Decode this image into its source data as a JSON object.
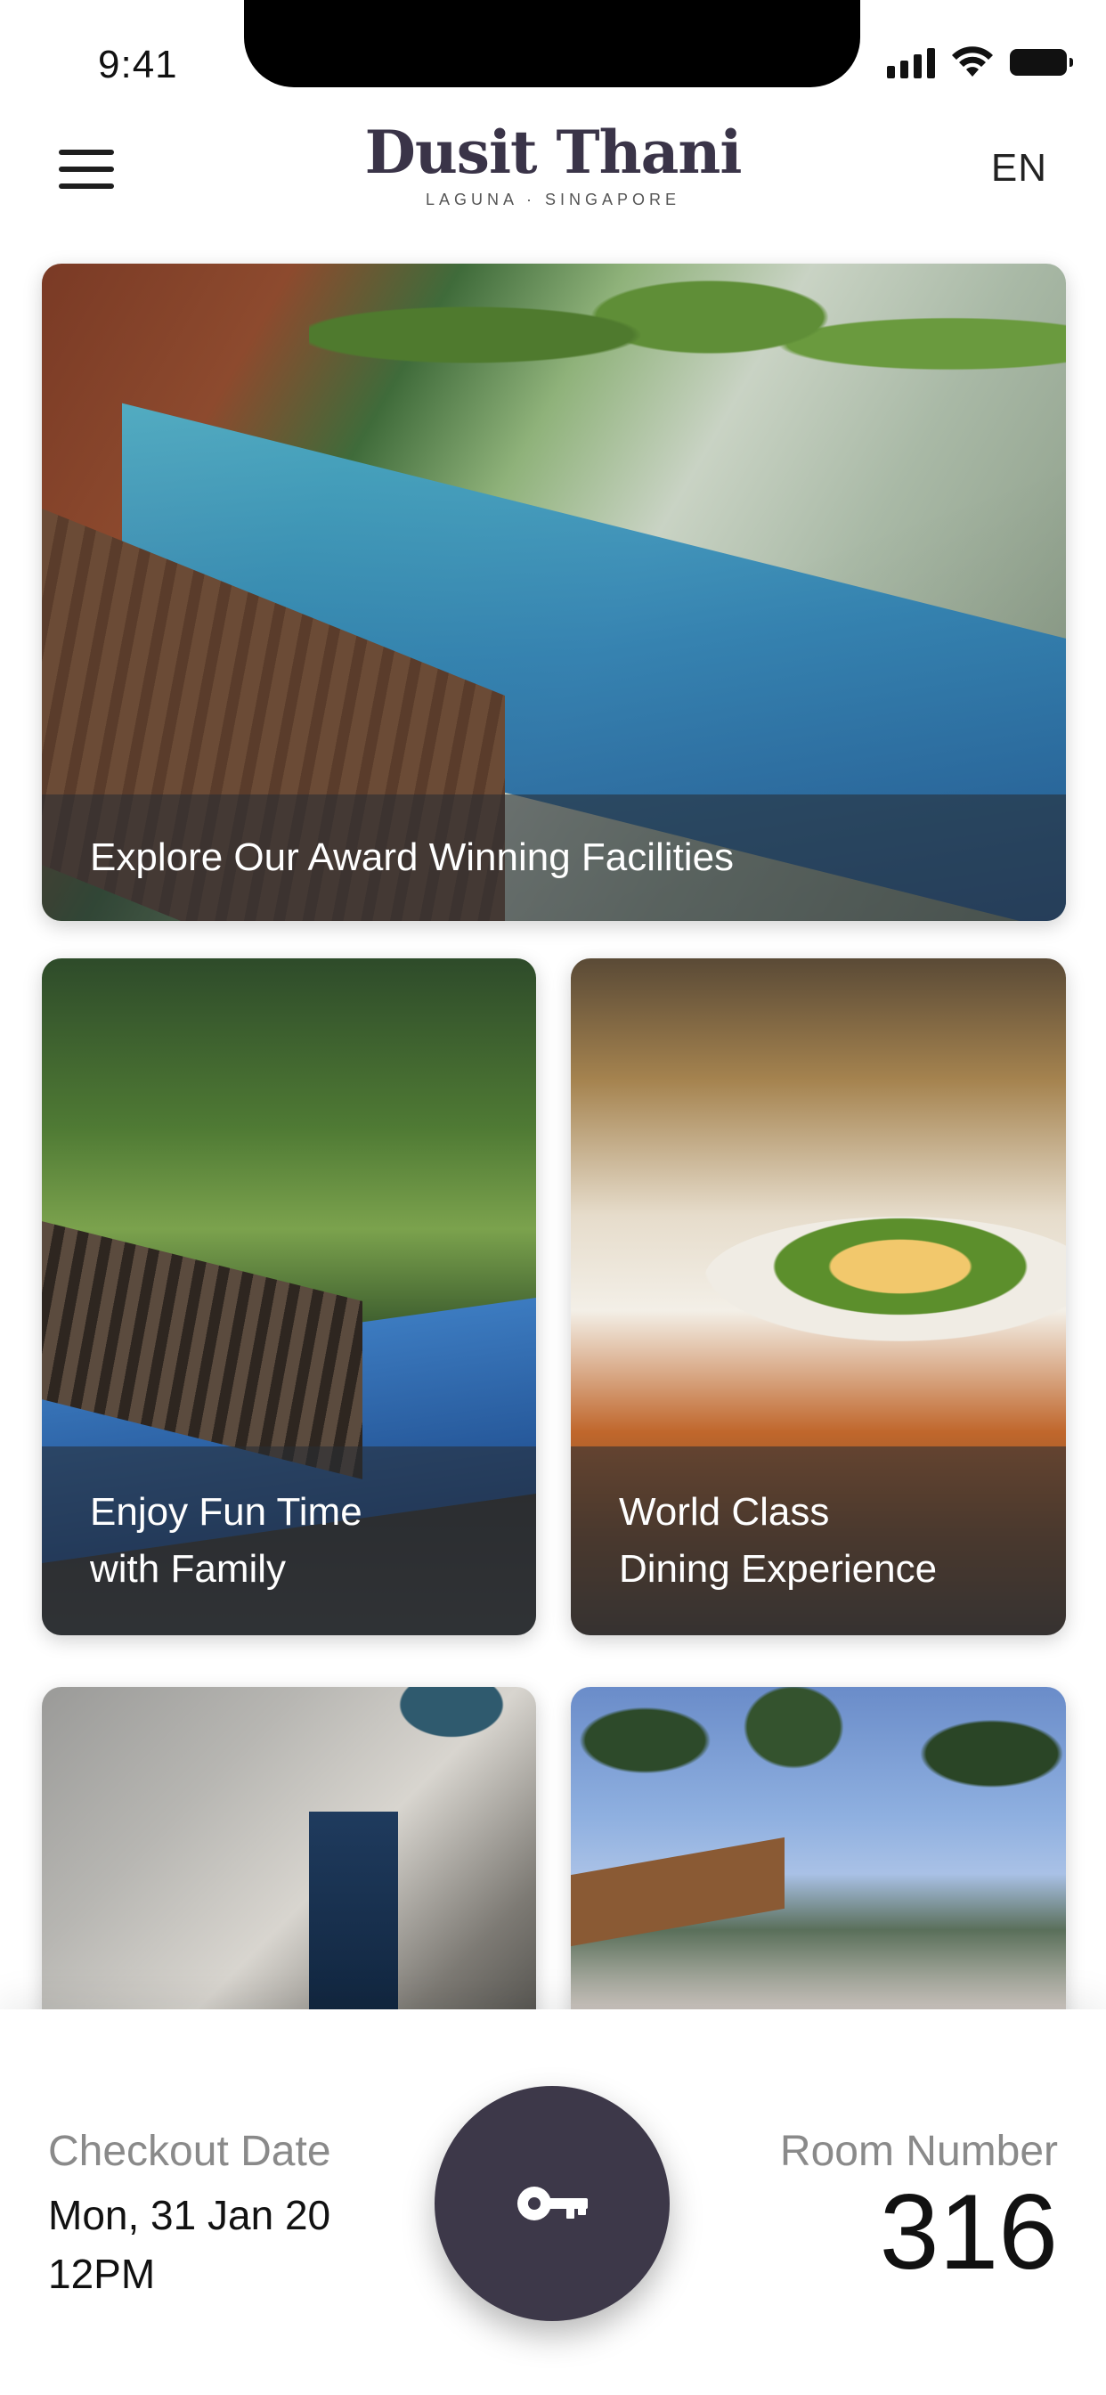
{
  "status_bar": {
    "time": "9:41"
  },
  "header": {
    "logo_title": "Dusit Thani",
    "logo_subtitle": "LAGUNA · SINGAPORE",
    "language": "EN"
  },
  "cards": [
    {
      "id": "facilities",
      "caption_lines": [
        "Explore Our Award Winning Facilities"
      ]
    },
    {
      "id": "family",
      "caption_lines": [
        "Enjoy Fun Time",
        "with Family"
      ]
    },
    {
      "id": "dining",
      "caption_lines": [
        "World Class",
        "Dining Experience"
      ]
    },
    {
      "id": "room",
      "caption_lines": []
    },
    {
      "id": "resort",
      "caption_lines": []
    }
  ],
  "booking": {
    "checkout_label": "Checkout Date",
    "checkout_date": "Mon, 31 Jan 20",
    "checkout_time": "12PM",
    "room_label": "Room Number",
    "room_number": "316"
  },
  "icons": {
    "menu": "hamburger-menu-icon",
    "key": "key-icon"
  },
  "colors": {
    "brand": "#3a3448",
    "key_button": "#3d3849"
  }
}
